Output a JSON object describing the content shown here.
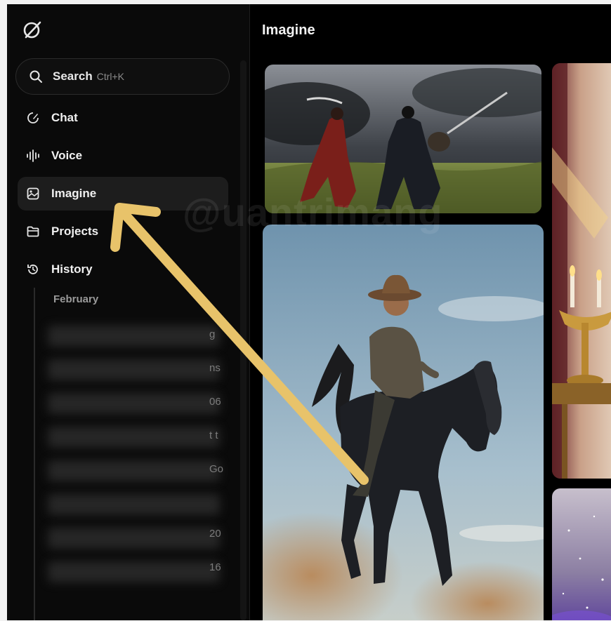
{
  "sidebar": {
    "search": {
      "label": "Search",
      "shortcut": "Ctrl+K"
    },
    "nav": [
      {
        "label": "Chat",
        "icon": "chat-edit-icon"
      },
      {
        "label": "Voice",
        "icon": "voice-waveform-icon"
      },
      {
        "label": "Imagine",
        "icon": "imagine-image-icon",
        "active": true
      },
      {
        "label": "Projects",
        "icon": "folder-icon"
      },
      {
        "label": "History",
        "icon": "history-clock-icon"
      }
    ],
    "history": {
      "section": "February",
      "tails": [
        "g",
        "ns",
        "06",
        "t t",
        "Go",
        "20",
        "16"
      ]
    }
  },
  "main": {
    "title": "Imagine"
  },
  "watermark": "@uantrimang",
  "colors": {
    "arrow": "#e8c36a",
    "active": "#1d1d1d",
    "background": "#000000"
  }
}
